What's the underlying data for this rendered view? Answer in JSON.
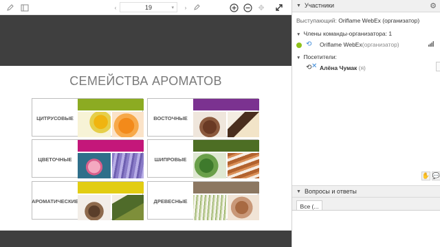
{
  "toolbar": {
    "page_value": "19",
    "icons": [
      "pencil-icon",
      "panel-icon",
      "chevron-up-icon",
      "chevron-down-icon",
      "annotate-icon",
      "zoom-in-icon",
      "zoom-out-icon",
      "move-icon",
      "expand-icon"
    ]
  },
  "slide": {
    "title": "СЕМЕЙСТВА АРОМАТОВ",
    "families": [
      {
        "name": "ЦИТРУСОВЫЕ",
        "color": "#8cab22"
      },
      {
        "name": "ВОСТОЧНЫЕ",
        "color": "#7b3290"
      },
      {
        "name": "ЦВЕТОЧНЫЕ",
        "color": "#c4177a"
      },
      {
        "name": "ШИПРОВЫЕ",
        "color": "#4d6e24"
      },
      {
        "name": "АРОМАТИЧЕСКИЕ",
        "color": "#e2cd12"
      },
      {
        "name": "ДРЕВЕСНЫЕ",
        "color": "#8c7761"
      }
    ]
  },
  "participants": {
    "header": "Участники",
    "presenter_label": "Выступающий:",
    "presenter_name": "Oriflame WebEx (организатор)",
    "team_section": "Члены команды-организатора: 1",
    "team_member_name": "Oriflame WebEx",
    "team_member_role": "(организатор)",
    "visitors_section": "Посетители:",
    "visitor_name": "Алёна Чумак",
    "visitor_role": "(я)"
  },
  "qa": {
    "header": "Вопросы и ответы",
    "tab_all": "Все (..."
  },
  "colors": {
    "status_online": "#8ec11a",
    "dark_band": "#3f3f3f",
    "panel_bg": "#f0f0f0"
  }
}
